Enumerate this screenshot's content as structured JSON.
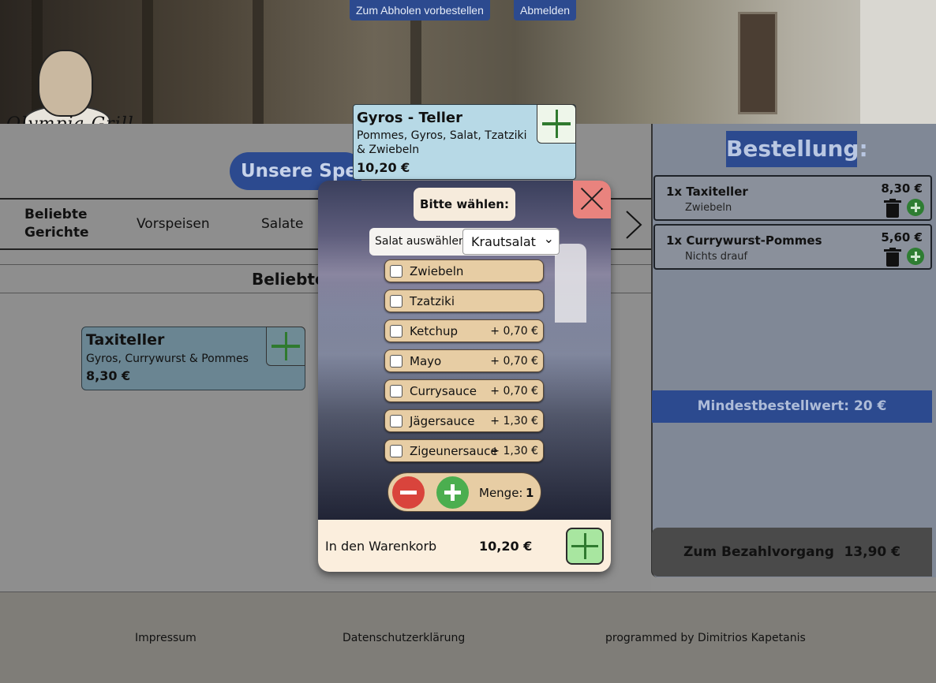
{
  "header": {
    "logo_text": "Olympia Grill",
    "pickup_button": "Zum Abholen vorbestellen",
    "logout_button": "Abmelden"
  },
  "menu": {
    "speisen_button": "Unsere Speisen",
    "categories": [
      {
        "label": "Beliebte Gerichte",
        "active": true
      },
      {
        "label": "Vorspeisen",
        "active": false
      },
      {
        "label": "Salate",
        "active": false
      }
    ],
    "section_title": "Beliebte Gerichte",
    "dishes": [
      {
        "name": "Taxiteller",
        "description": "Gyros, Currywurst & Pommes",
        "price": "8,30 €",
        "color": "#6a8592"
      }
    ]
  },
  "gyros_card": {
    "name": "Gyros - Teller",
    "description": "Pommes, Gyros, Salat, Tzatziki & Zwiebeln",
    "price": "10,20 €",
    "color": "#b7d9e6"
  },
  "modal": {
    "title": "Bitte wählen:",
    "salad_label": "Salat auswählen:",
    "salad_selected": "Krautsalat",
    "options": [
      {
        "label": "Zwiebeln",
        "extra": ""
      },
      {
        "label": "Tzatziki",
        "extra": ""
      },
      {
        "label": "Ketchup",
        "extra": "+ 0,70 €"
      },
      {
        "label": "Mayo",
        "extra": "+ 0,70 €"
      },
      {
        "label": "Currysauce",
        "extra": "+ 0,70 €"
      },
      {
        "label": "Jägersauce",
        "extra": "+ 1,30 €"
      },
      {
        "label": "Zigeunersauce",
        "extra": "+ 1,30 €"
      }
    ],
    "quantity_label": "Menge:",
    "quantity": "1",
    "cart_label": "In den Warenkorb",
    "cart_price": "10,20 €"
  },
  "order": {
    "title": "Bestellung:",
    "items": [
      {
        "name": "1x Taxiteller",
        "note": "Zwiebeln",
        "price": "8,30 €"
      },
      {
        "name": "1x Currywurst-Pommes",
        "note": "Nichts drauf",
        "price": "5,60 €"
      }
    ],
    "minimum": "Mindestbestellwert: 20 €",
    "pay_label": "Zum Bezahlvorgang",
    "total": "13,90 €"
  },
  "footer": {
    "impressum": "Impressum",
    "privacy": "Datenschutzerklärung",
    "credit": "programmed by Dimitrios Kapetanis"
  },
  "colors": {
    "accent_blue": "#2c4a8f",
    "add_green": "#2f7a2f",
    "remove_red": "#d9443c",
    "option_tan": "#e7cda4"
  }
}
